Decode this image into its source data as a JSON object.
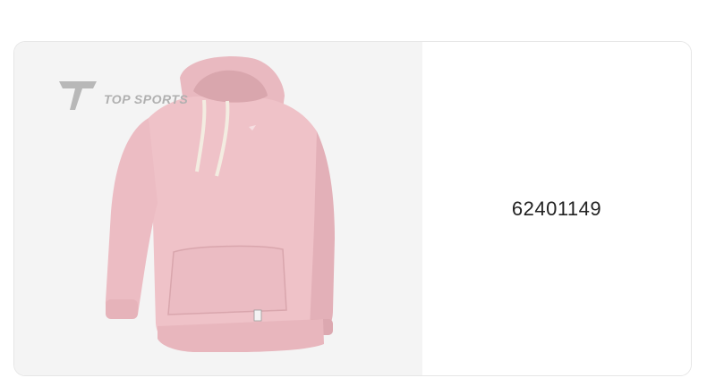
{
  "brand": {
    "logo_text": "TOP SPORTS"
  },
  "product": {
    "image_alt": "pink hoodie",
    "code": "62401149",
    "colors": {
      "hoodie": "#efc2c8",
      "hoodie_shadow": "#d9a6ad",
      "background": "#f4f4f4",
      "drawstring": "#f3ece1"
    }
  }
}
